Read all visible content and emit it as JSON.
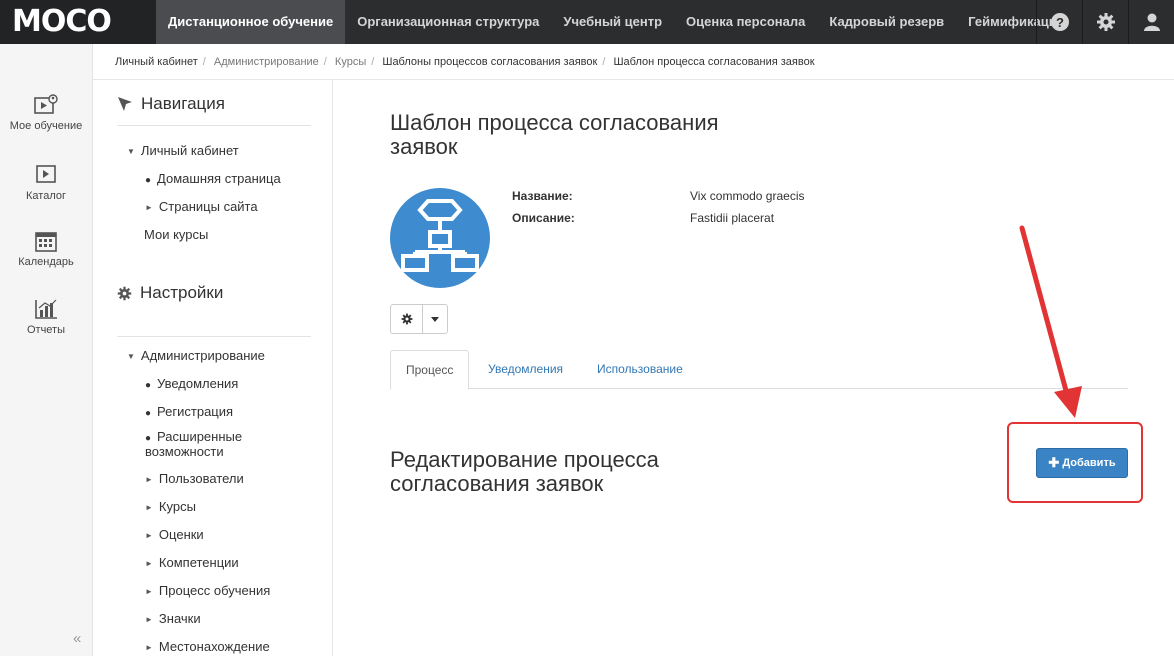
{
  "header": {
    "logo": "MOCO",
    "menu": [
      {
        "label": "Дистанционное обучение"
      },
      {
        "label": "Организационная структура"
      },
      {
        "label": "Учебный центр"
      },
      {
        "label": "Оценка персонала"
      },
      {
        "label": "Кадровый резерв"
      },
      {
        "label": "Геймификация"
      }
    ],
    "icons": [
      "help-icon",
      "gear-icon",
      "user-icon"
    ]
  },
  "rail": {
    "items": [
      {
        "label": "Мое обучение",
        "icon": "my-learning-icon"
      },
      {
        "label": "Каталог",
        "icon": "catalog-icon"
      },
      {
        "label": "Календарь",
        "icon": "calendar-icon"
      },
      {
        "label": "Отчеты",
        "icon": "reports-icon"
      }
    ],
    "collapse": "«"
  },
  "breadcrumb": [
    "Личный кабинет",
    "Администрирование",
    "Курсы",
    "Шаблоны процессов согласования заявок",
    "Шаблон процесса согласования заявок"
  ],
  "nav": {
    "navigation_title": "Навигация",
    "personal": "Личный кабинет",
    "home": "Домашняя страница",
    "site_pages": "Страницы сайта",
    "my_courses": "Мои курсы",
    "settings_title": "Настройки",
    "admin": "Администрирование",
    "admin_items": [
      "Уведомления",
      "Регистрация",
      "Расширенные возможности",
      "Пользователи",
      "Курсы",
      "Оценки",
      "Компетенции",
      "Процесс обучения",
      "Значки",
      "Местонахождение"
    ]
  },
  "main": {
    "title": "Шаблон процесса согласования заявок",
    "fields": [
      {
        "label": "Название:",
        "value": "Vix commodo graecis"
      },
      {
        "label": "Описание:",
        "value": "Fastidii placerat"
      }
    ],
    "tabs": [
      "Процесс",
      "Уведомления",
      "Использование"
    ],
    "section_title": "Редактирование процесса согласования заявок",
    "add_button": "Добавить"
  },
  "colors": {
    "topbar": "#2b2d2f",
    "accent": "#3a84c6",
    "avatar": "#3e8ccf",
    "annotation": "#e23434"
  }
}
